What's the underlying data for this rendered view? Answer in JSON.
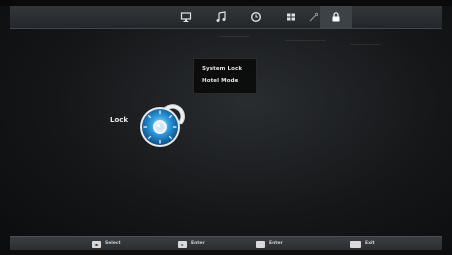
{
  "topbar": {
    "icons": [
      "picture-icon",
      "music-icon",
      "clock-icon",
      "apps-icon",
      "settings-icon",
      "lock-icon"
    ],
    "selected": "lock-icon"
  },
  "menu": {
    "items": [
      {
        "label": "System Lock"
      },
      {
        "label": "Hotel Mode"
      }
    ]
  },
  "page": {
    "lock_label": "Lock"
  },
  "bottombar": {
    "hints": [
      {
        "key": "◂▸",
        "label": "Select"
      },
      {
        "key": "▸",
        "label": "Enter"
      },
      {
        "key": "",
        "label": "Enter"
      },
      {
        "key": "",
        "label": "Exit"
      }
    ]
  },
  "colors": {
    "accent": "#1f8fd1",
    "background": "#141618",
    "bar": "#2e3236",
    "text": "#e6e6e6"
  }
}
